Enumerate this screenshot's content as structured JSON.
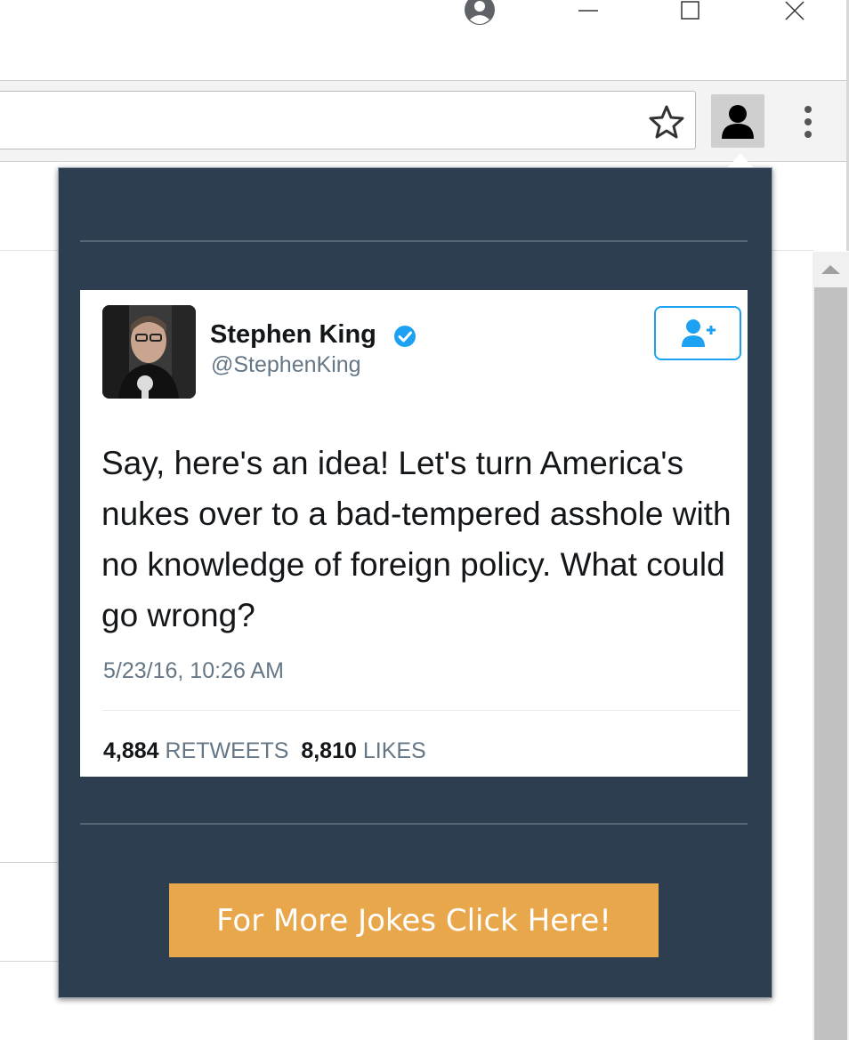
{
  "window": {
    "controls": [
      "minimize",
      "maximize",
      "close"
    ],
    "icons": [
      "account-circle-icon",
      "minimize-icon",
      "maximize-icon",
      "close-icon"
    ]
  },
  "toolbar": {
    "icons": [
      "bookmark-star-icon",
      "user-silhouette-icon",
      "kebab-menu-icon"
    ]
  },
  "tweet": {
    "name": "Stephen King",
    "handle": "@StephenKing",
    "text": "Say, here's an idea! Let's turn America's nukes over to a bad-tempered asshole with no knowledge of foreign policy. What could go wrong?",
    "timestamp": "5/23/16, 10:26 AM",
    "retweets_count": "4,884",
    "retweets_label": "RETWEETS",
    "likes_count": "8,810",
    "likes_label": "LIKES",
    "verified_color": "#1da1f2",
    "follow_icon": "follow-user-icon"
  },
  "cta": {
    "label": "For More Jokes Click Here!",
    "color": "#e8a74a"
  },
  "popup": {
    "background": "#2c3e50"
  }
}
